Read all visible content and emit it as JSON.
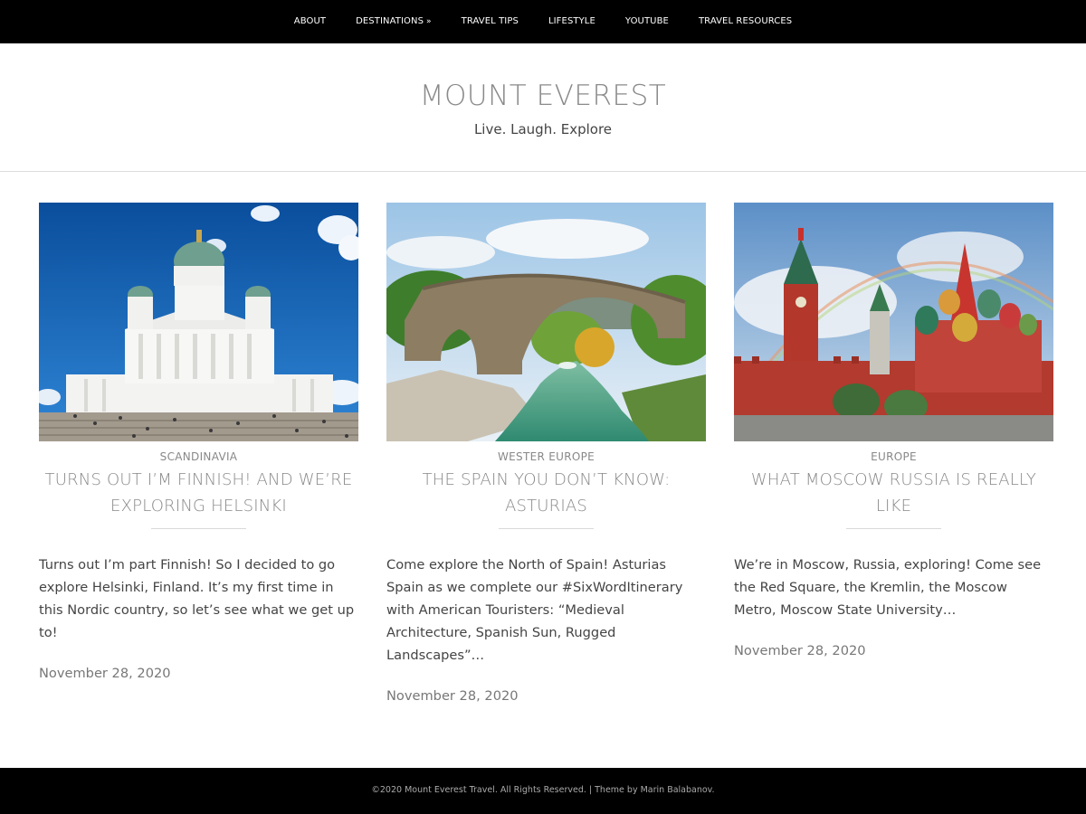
{
  "nav": {
    "items": [
      {
        "label": "ABOUT"
      },
      {
        "label": "DESTINATIONS",
        "caret": "»"
      },
      {
        "label": "TRAVEL TIPS"
      },
      {
        "label": "LIFESTYLE"
      },
      {
        "label": "YOUTUBE"
      },
      {
        "label": "TRAVEL RESOURCES"
      }
    ]
  },
  "header": {
    "title": "MOUNT EVEREST",
    "tagline": "Live. Laugh. Explore"
  },
  "posts": [
    {
      "category": "SCANDINAVIA",
      "title": "TURNS OUT I’M FINNISH! AND WE’RE EXPLORING HELSINKI",
      "excerpt": "Turns out I’m part Finnish! So I decided to go explore Helsinki, Finland. It’s my first time in this Nordic country, so let’s see what we get up to!",
      "date": "November 28, 2020",
      "image": "helsinki-cathedral-photo"
    },
    {
      "category": "WESTER EUROPE",
      "title": "THE SPAIN YOU DON’T KNOW: ASTURIAS",
      "excerpt": "Come explore the North of Spain! Asturias Spain as we complete our #SixWordItinerary with American Touristers: “Medieval Architecture, Spanish Sun, Rugged Landscapes”…",
      "date": "November 28, 2020",
      "image": "asturias-stone-bridge-photo"
    },
    {
      "category": "EUROPE",
      "title": "WHAT MOSCOW RUSSIA IS REALLY LIKE",
      "excerpt": "We’re in Moscow, Russia, exploring! Come see the Red Square, the Kremlin, the Moscow Metro, Moscow State University…",
      "date": "November 28, 2020",
      "image": "moscow-red-square-photo"
    }
  ],
  "footer": {
    "text": "©2020 Mount Everest Travel. All Rights Reserved. | Theme by Marin Balabanov."
  }
}
